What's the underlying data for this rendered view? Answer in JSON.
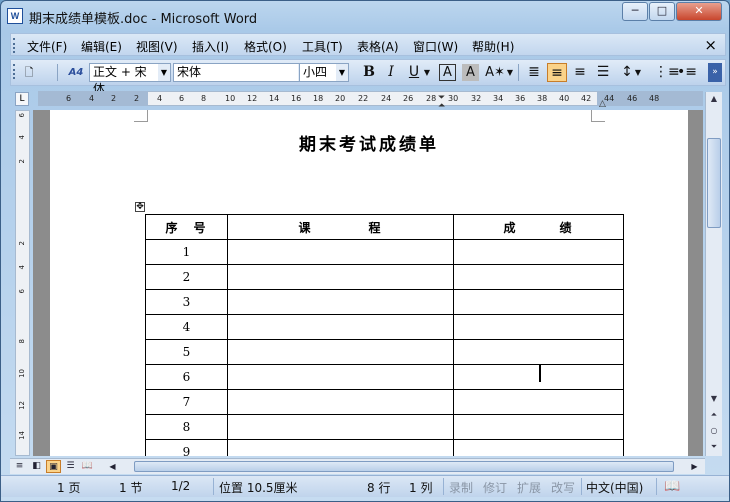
{
  "window": {
    "title": "期末成绩单模板.doc - Microsoft Word",
    "icon": "W",
    "min": "─",
    "max": "□",
    "close": "✕"
  },
  "menu": [
    "文件(F)",
    "编辑(E)",
    "视图(V)",
    "插入(I)",
    "格式(O)",
    "工具(T)",
    "表格(A)",
    "窗口(W)",
    "帮助(H)"
  ],
  "menu_close": "×",
  "toolbar": {
    "style_icon": "A4",
    "style_value": "正文 + 宋体",
    "font_value": "宋体",
    "size_value": "小四",
    "bold": "B",
    "italic": "I",
    "underline": "U",
    "border_char": "A",
    "shade_char": "A"
  },
  "ruler": {
    "numbers": [
      "6",
      "4",
      "2",
      "2",
      "4",
      "6",
      "8",
      "10",
      "12",
      "14",
      "16",
      "18",
      "20",
      "22",
      "24",
      "26",
      "28",
      "30",
      "32",
      "34",
      "36",
      "38",
      "40",
      "42",
      "44",
      "46",
      "48"
    ],
    "tab_selector": "L"
  },
  "vruler": {
    "numbers": [
      "6",
      "4",
      "2",
      "2",
      "4",
      "6",
      "8",
      "10",
      "12",
      "14"
    ]
  },
  "document": {
    "title": "期末考试成绩单",
    "table": {
      "headers": [
        "序　号",
        "课　　　　程",
        "成　　　绩"
      ],
      "rows": [
        [
          "1",
          "",
          ""
        ],
        [
          "2",
          "",
          ""
        ],
        [
          "3",
          "",
          ""
        ],
        [
          "4",
          "",
          ""
        ],
        [
          "5",
          "",
          ""
        ],
        [
          "6",
          "",
          ""
        ],
        [
          "7",
          "",
          ""
        ],
        [
          "8",
          "",
          ""
        ],
        [
          "9",
          "",
          ""
        ]
      ]
    }
  },
  "status": {
    "page": "1 页",
    "section": "1 节",
    "page_of": "1/2",
    "position": "位置 10.5厘米",
    "line": "8 行",
    "col": "1 列",
    "rec": "录制",
    "trk": "修订",
    "ext": "扩展",
    "ovr": "改写",
    "lang": "中文(中国)"
  }
}
